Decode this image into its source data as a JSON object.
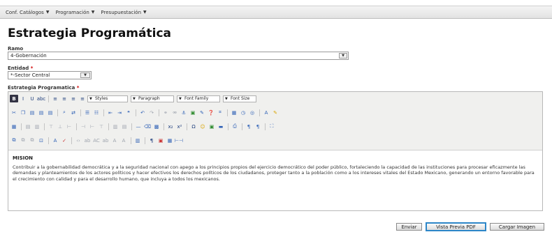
{
  "nav": {
    "items": [
      {
        "label": "Conf. Catálogos",
        "caret": "▼"
      },
      {
        "label": "Programación",
        "caret": "▼"
      },
      {
        "label": "Presupuestación",
        "caret": "▼"
      }
    ]
  },
  "page": {
    "title": "Estrategia Programática"
  },
  "form": {
    "ramo": {
      "label": "Ramo",
      "value": "4-Gobernación"
    },
    "entidad": {
      "label": "Entidad",
      "value": "*-Sector Central",
      "required_mark": "*"
    },
    "estrategia": {
      "label": "Estrategia Programatica",
      "required_mark": "*"
    }
  },
  "toolbar": {
    "styles": "Styles",
    "paragraph": "Paragraph",
    "font_family": "Font Family",
    "font_size": "Font Size",
    "dropdown_caret": "▼",
    "row1": [
      {
        "name": "bold-icon",
        "glyph": "B",
        "cls": "bold-b"
      },
      {
        "name": "italic-icon",
        "glyph": "I",
        "cls": ""
      },
      {
        "name": "underline-icon",
        "glyph": "U",
        "cls": ""
      },
      {
        "name": "strikethrough-icon",
        "glyph": "abc",
        "cls": ""
      },
      {
        "name": "sep",
        "glyph": "",
        "cls": "sep"
      },
      {
        "name": "align-left-icon",
        "glyph": "≡",
        "cls": ""
      },
      {
        "name": "align-center-icon",
        "glyph": "≡",
        "cls": ""
      },
      {
        "name": "align-right-icon",
        "glyph": "≡",
        "cls": ""
      },
      {
        "name": "align-justify-icon",
        "glyph": "≡",
        "cls": ""
      }
    ],
    "row2": [
      {
        "name": "cut-icon",
        "glyph": "✂",
        "cls": "ic-blue"
      },
      {
        "name": "copy-icon",
        "glyph": "❐",
        "cls": "ic-blue"
      },
      {
        "name": "paste-icon",
        "glyph": "▤",
        "cls": "ic-blue"
      },
      {
        "name": "paste-text-icon",
        "glyph": "▤",
        "cls": "ic-blue"
      },
      {
        "name": "paste-word-icon",
        "glyph": "▤",
        "cls": "ic-blue"
      },
      {
        "name": "sep",
        "glyph": "",
        "cls": "sep"
      },
      {
        "name": "find-icon",
        "glyph": "⌕",
        "cls": "ic-blue"
      },
      {
        "name": "replace-icon",
        "glyph": "⇄",
        "cls": "ic-blue"
      },
      {
        "name": "sep",
        "glyph": "",
        "cls": "sep"
      },
      {
        "name": "bullet-list-icon",
        "glyph": "☰",
        "cls": "ic-blue"
      },
      {
        "name": "numbered-list-icon",
        "glyph": "☷",
        "cls": "ic-blue"
      },
      {
        "name": "sep",
        "glyph": "",
        "cls": "sep"
      },
      {
        "name": "outdent-icon",
        "glyph": "⇤",
        "cls": "ic-blue"
      },
      {
        "name": "indent-icon",
        "glyph": "⇥",
        "cls": "ic-blue"
      },
      {
        "name": "blockquote-icon",
        "glyph": "❝",
        "cls": "ic-blue"
      },
      {
        "name": "sep",
        "glyph": "",
        "cls": "sep"
      },
      {
        "name": "undo-icon",
        "glyph": "↶",
        "cls": "ic-blue"
      },
      {
        "name": "redo-icon",
        "glyph": "↷",
        "cls": "ic-gray"
      },
      {
        "name": "sep",
        "glyph": "",
        "cls": "sep"
      },
      {
        "name": "link-icon",
        "glyph": "⚭",
        "cls": "ic-gray"
      },
      {
        "name": "unlink-icon",
        "glyph": "⚮",
        "cls": "ic-gray"
      },
      {
        "name": "anchor-icon",
        "glyph": "⚓",
        "cls": "ic-blue"
      },
      {
        "name": "image-icon",
        "glyph": "▣",
        "cls": "ic-green"
      },
      {
        "name": "cleanup-icon",
        "glyph": "✎",
        "cls": "ic-blue"
      },
      {
        "name": "help-icon",
        "glyph": "❓",
        "cls": "ic-blue"
      },
      {
        "name": "html-icon",
        "glyph": "⌗",
        "cls": "ic-blue"
      },
      {
        "name": "sep",
        "glyph": "",
        "cls": "sep"
      },
      {
        "name": "date-icon",
        "glyph": "▦",
        "cls": "ic-blue"
      },
      {
        "name": "time-icon",
        "glyph": "◷",
        "cls": "ic-blue"
      },
      {
        "name": "preview-icon",
        "glyph": "◎",
        "cls": "ic-blue"
      },
      {
        "name": "sep",
        "glyph": "",
        "cls": "sep"
      },
      {
        "name": "text-color-icon",
        "glyph": "A",
        "cls": "ic-blue"
      },
      {
        "name": "bg-color-icon",
        "glyph": "✎",
        "cls": "ic-yellow"
      }
    ],
    "row3": [
      {
        "name": "table-icon",
        "glyph": "▦",
        "cls": "ic-blue"
      },
      {
        "name": "sep",
        "glyph": "",
        "cls": "sep"
      },
      {
        "name": "row-props-icon",
        "glyph": "▤",
        "cls": "ic-gray"
      },
      {
        "name": "cell-props-icon",
        "glyph": "▥",
        "cls": "ic-gray"
      },
      {
        "name": "sep",
        "glyph": "",
        "cls": "sep"
      },
      {
        "name": "row-before-icon",
        "glyph": "⊤",
        "cls": "ic-gray"
      },
      {
        "name": "row-after-icon",
        "glyph": "⊥",
        "cls": "ic-gray"
      },
      {
        "name": "delete-row-icon",
        "glyph": "⊢",
        "cls": "ic-gray"
      },
      {
        "name": "sep",
        "glyph": "",
        "cls": "sep"
      },
      {
        "name": "col-before-icon",
        "glyph": "⊣",
        "cls": "ic-gray"
      },
      {
        "name": "col-after-icon",
        "glyph": "⊢",
        "cls": "ic-gray"
      },
      {
        "name": "delete-col-icon",
        "glyph": "⊤",
        "cls": "ic-gray"
      },
      {
        "name": "sep",
        "glyph": "",
        "cls": "sep"
      },
      {
        "name": "split-cells-icon",
        "glyph": "▥",
        "cls": "ic-gray"
      },
      {
        "name": "merge-cells-icon",
        "glyph": "▤",
        "cls": "ic-gray"
      },
      {
        "name": "sep",
        "glyph": "",
        "cls": "sep"
      },
      {
        "name": "hr-icon",
        "glyph": "—",
        "cls": "ic-blue"
      },
      {
        "name": "remove-format-icon",
        "glyph": "⌫",
        "cls": "ic-blue"
      },
      {
        "name": "visual-aid-icon",
        "glyph": "▩",
        "cls": "ic-blue"
      },
      {
        "name": "sep",
        "glyph": "",
        "cls": "sep"
      },
      {
        "name": "subscript-icon",
        "glyph": "x₂",
        "cls": ""
      },
      {
        "name": "superscript-icon",
        "glyph": "x²",
        "cls": ""
      },
      {
        "name": "sep",
        "glyph": "",
        "cls": "sep"
      },
      {
        "name": "special-char-icon",
        "glyph": "Ω",
        "cls": ""
      },
      {
        "name": "emotion-icon",
        "glyph": "☺",
        "cls": "ic-yellow"
      },
      {
        "name": "media-icon",
        "glyph": "▣",
        "cls": "ic-green"
      },
      {
        "name": "advhr-icon",
        "glyph": "▬",
        "cls": "ic-blue"
      },
      {
        "name": "sep",
        "glyph": "",
        "cls": "sep"
      },
      {
        "name": "print-icon",
        "glyph": "⎙",
        "cls": "ic-blue"
      },
      {
        "name": "sep",
        "glyph": "",
        "cls": "sep"
      },
      {
        "name": "ltr-icon",
        "glyph": "¶",
        "cls": "ic-blue"
      },
      {
        "name": "rtl-icon",
        "glyph": "¶",
        "cls": "ic-blue"
      },
      {
        "name": "sep",
        "glyph": "",
        "cls": "sep"
      },
      {
        "name": "fullscreen-icon",
        "glyph": "⛶",
        "cls": "ic-blue"
      }
    ],
    "row4": [
      {
        "name": "insert-layer-icon",
        "glyph": "⧉",
        "cls": "ic-blue"
      },
      {
        "name": "move-forward-icon",
        "glyph": "⧉",
        "cls": "ic-gray"
      },
      {
        "name": "move-backward-icon",
        "glyph": "⧉",
        "cls": "ic-gray"
      },
      {
        "name": "absolute-icon",
        "glyph": "⊡",
        "cls": "ic-blue"
      },
      {
        "name": "sep",
        "glyph": "",
        "cls": "sep"
      },
      {
        "name": "styleprops-icon",
        "glyph": "A",
        "cls": "ic-blue"
      },
      {
        "name": "spellcheck-icon",
        "glyph": "✓",
        "cls": "ic-red"
      },
      {
        "name": "sep",
        "glyph": "",
        "cls": "sep"
      },
      {
        "name": "cite-icon",
        "glyph": "‹›",
        "cls": "ic-gray"
      },
      {
        "name": "abbr-icon",
        "glyph": "ab",
        "cls": "ic-gray"
      },
      {
        "name": "acronym-icon",
        "glyph": "AC",
        "cls": "ic-gray"
      },
      {
        "name": "del-icon",
        "glyph": "ab",
        "cls": "ic-gray"
      },
      {
        "name": "ins-icon",
        "glyph": "A",
        "cls": "ic-gray"
      },
      {
        "name": "attribs-icon",
        "glyph": "A",
        "cls": "ic-gray"
      },
      {
        "name": "sep",
        "glyph": "",
        "cls": "sep"
      },
      {
        "name": "template-icon",
        "glyph": "▥",
        "cls": "ic-blue"
      },
      {
        "name": "sep",
        "glyph": "",
        "cls": "sep"
      },
      {
        "name": "pilcrow-icon",
        "glyph": "¶",
        "cls": ""
      },
      {
        "name": "pagebreak-icon",
        "glyph": "▣",
        "cls": "ic-red"
      },
      {
        "name": "nonbreaking-icon",
        "glyph": "▦",
        "cls": "ic-blue"
      },
      {
        "name": "visualchars-icon",
        "glyph": "⊢⊣",
        "cls": "ic-blue"
      }
    ]
  },
  "content": {
    "heading": "MISION",
    "body": "Contribuir a la gobernabilidad democrática y a la seguridad nacional con apego a los principios propios del ejercicio democrático del poder público, fortaleciendo la capacidad de las instituciones para procesar eficazmente las demandas y planteamientos de los actores políticos y hacer efectivos los derechos políticos de los ciudadanos, proteger tanto a la población como a los intereses vitales del Estado Mexicano, generando un entorno favorable para el crecimiento con calidad y para el desarrollo humano, que incluya a todos los mexicanos."
  },
  "buttons": {
    "enviar": "Enviar",
    "vista_previa": "Vista Previa PDF",
    "cargar_imagen": "Cargar Imagen"
  }
}
